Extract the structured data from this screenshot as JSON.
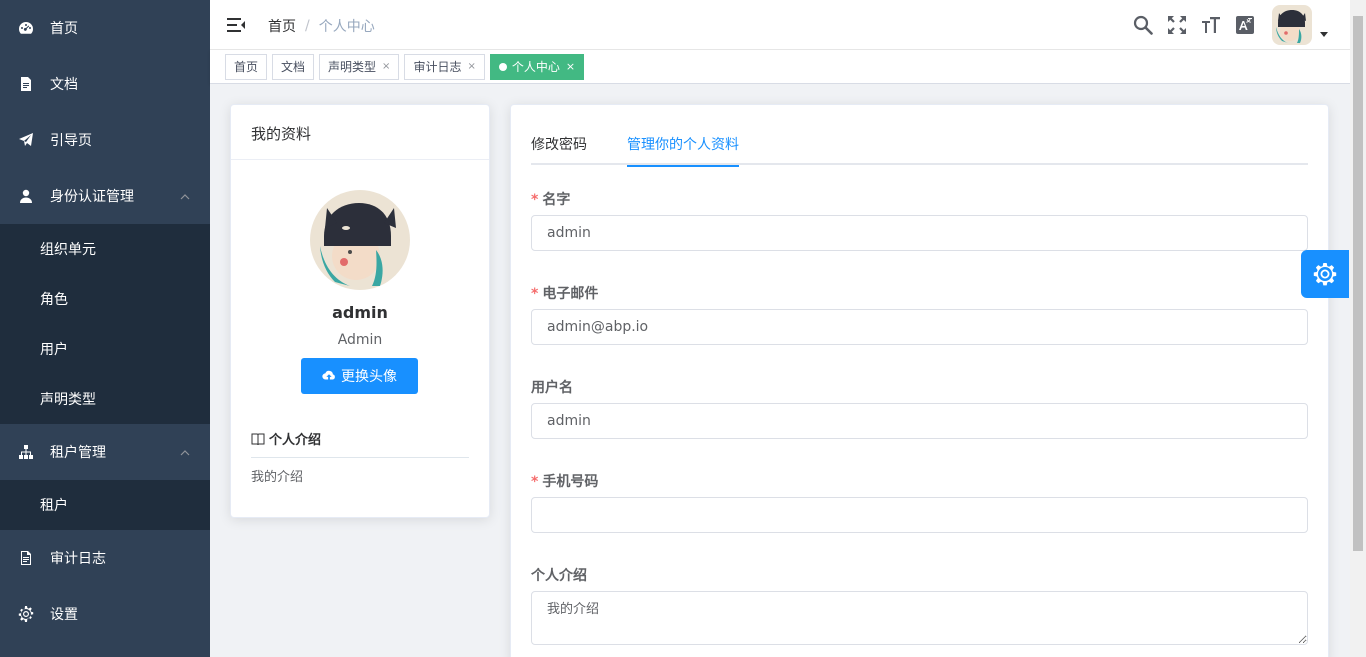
{
  "sidebar": {
    "items": [
      {
        "label": "首页",
        "icon": "dashboard-icon"
      },
      {
        "label": "文档",
        "icon": "document-icon"
      },
      {
        "label": "引导页",
        "icon": "guide-icon"
      },
      {
        "label": "身份认证管理",
        "icon": "user-icon",
        "expanded": true
      },
      {
        "label": "租户管理",
        "icon": "tree-icon",
        "expanded": true
      },
      {
        "label": "审计日志",
        "icon": "log-icon"
      },
      {
        "label": "设置",
        "icon": "gear-icon"
      }
    ],
    "identity_sub": [
      "组织单元",
      "角色",
      "用户",
      "声明类型"
    ],
    "tenant_sub": [
      "租户"
    ]
  },
  "navbar": {
    "breadcrumb_home": "首页",
    "breadcrumb_sep": "/",
    "breadcrumb_current": "个人中心"
  },
  "tags": [
    {
      "label": "首页",
      "closable": false
    },
    {
      "label": "文档",
      "closable": false
    },
    {
      "label": "声明类型",
      "closable": true
    },
    {
      "label": "审计日志",
      "closable": true
    },
    {
      "label": "个人中心",
      "closable": true,
      "active": true
    }
  ],
  "tag_close": "×",
  "profile_card": {
    "title": "我的资料",
    "name": "admin",
    "role": "Admin",
    "upload_label": "更换头像",
    "intro_title": "个人介绍",
    "intro_text": "我的介绍"
  },
  "tabs": [
    {
      "label": "修改密码"
    },
    {
      "label": "管理你的个人资料",
      "active": true
    }
  ],
  "form": {
    "required_mark": "*",
    "name_label": "名字",
    "name_value": "admin",
    "email_label": "电子邮件",
    "email_value": "admin@abp.io",
    "username_label": "用户名",
    "username_value": "admin",
    "phone_label": "手机号码",
    "phone_value": "",
    "intro_label": "个人介绍",
    "intro_value": "我的介绍"
  },
  "colors": {
    "sidebar_bg": "#304156",
    "submenu_bg": "#1f2d3d",
    "primary": "#1890ff",
    "tag_active": "#42b983",
    "required": "#f56c6c"
  }
}
